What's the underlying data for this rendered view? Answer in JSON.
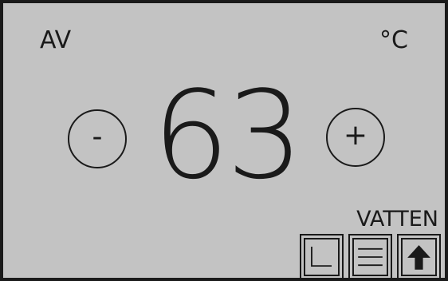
{
  "display": {
    "mode": "AV",
    "unit": "°C",
    "temperature": "63",
    "category": "VATTEN"
  },
  "buttons": {
    "decrease_label": "-",
    "increase_label": "+"
  },
  "icons": {
    "left": "corner-l-icon",
    "middle": "menu-lines-icon",
    "right": "arrow-up-icon"
  },
  "colors": {
    "background": "#c3c3c3",
    "foreground": "#1a1a1a"
  }
}
